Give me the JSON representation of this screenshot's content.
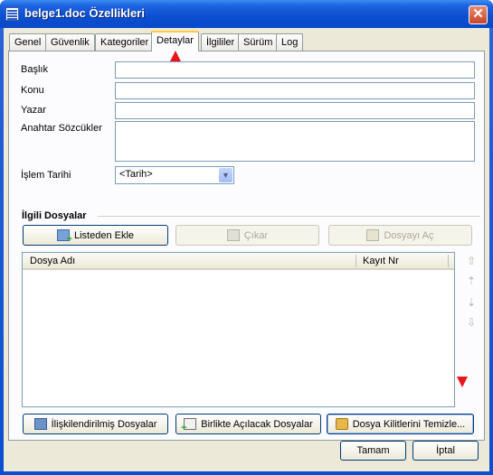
{
  "window": {
    "title": "belge1.doc Özellikleri",
    "close_symbol": "✕",
    "title_icon": "word-document-icon"
  },
  "tabs": [
    {
      "label": "Genel",
      "active": false
    },
    {
      "label": "Güvenlik",
      "active": false
    },
    {
      "label": "Kategoriler",
      "active": false
    },
    {
      "label": "Detaylar",
      "active": true
    },
    {
      "label": "İlgililer",
      "active": false
    },
    {
      "label": "Sürüm",
      "active": false
    },
    {
      "label": "Log",
      "active": false
    }
  ],
  "fields": {
    "baslik": {
      "label": "Başlık",
      "value": ""
    },
    "konu": {
      "label": "Konu",
      "value": ""
    },
    "yazar": {
      "label": "Yazar",
      "value": ""
    },
    "anahtar": {
      "label": "Anahtar Sözcükler",
      "value": ""
    },
    "islem_tarihi": {
      "label": "İşlem Tarihi",
      "value": "<Tarih>"
    }
  },
  "related_files": {
    "section_title": "İlgili Dosyalar",
    "add_button": "Listeden Ekle",
    "remove_button": "Çıkar",
    "open_button": "Dosyayı Aç",
    "columns": [
      "Dosya Adı",
      "Kayıt Nr"
    ],
    "rows": []
  },
  "bottom_buttons": {
    "related": "İlişkilendirilmiş Dosyalar",
    "open_together": "Birlikte Açılacak Dosyalar",
    "clear_locks": "Dosya Kilitlerini Temizle..."
  },
  "dialog_buttons": {
    "ok": "Tamam",
    "cancel": "İptal"
  },
  "colors": {
    "title_bar": "#0a4fd0",
    "active_tab_highlight": "#ffc83c",
    "marker": "#e8171c"
  }
}
